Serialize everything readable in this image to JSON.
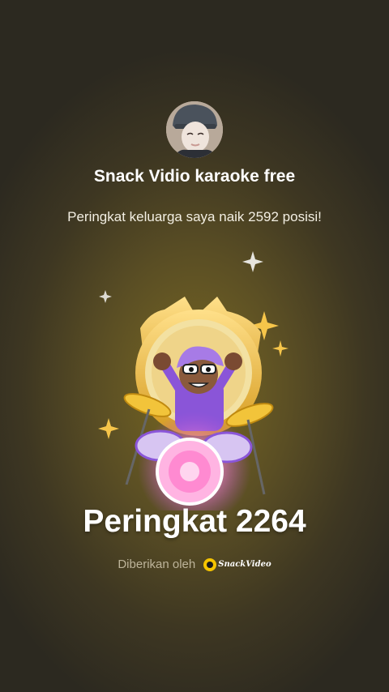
{
  "header": {
    "group_name": "Snack Vidio karaoke free",
    "message": "Peringkat keluarga saya naik 2592 posisi!"
  },
  "badge": {
    "icon": "drummer-badge-icon"
  },
  "rank": {
    "title": "Peringkat 2264"
  },
  "footer": {
    "given_by_label": "Diberikan oleh",
    "brand_name": "SnackVideo",
    "brand_icon": "snackvideo-logo-icon"
  },
  "colors": {
    "gold": "#e8b53a",
    "purple": "#8a55d8",
    "pink": "#ff8ad1"
  }
}
